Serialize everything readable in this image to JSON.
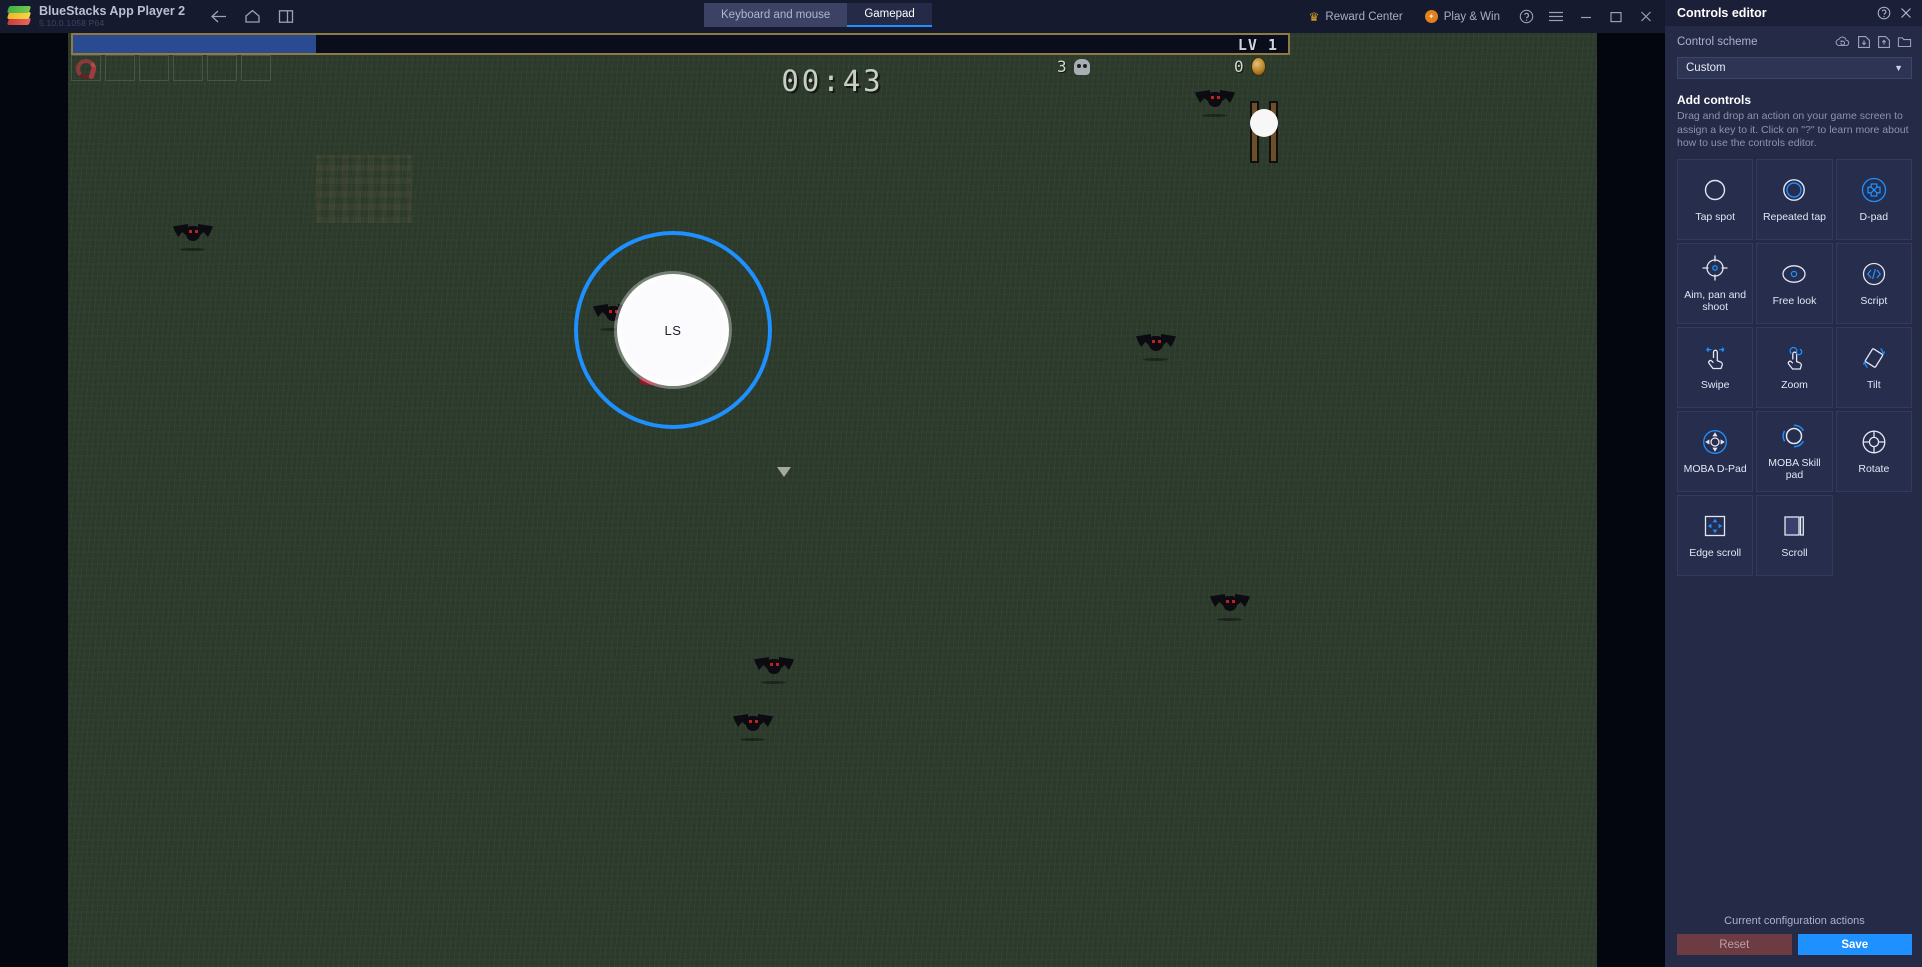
{
  "titlebar": {
    "app_title": "BlueStacks App Player 2",
    "version": "5.10.0.1058  P64",
    "logo_icon": "bluestacks-logo",
    "nav": [
      {
        "icon": "back-arrow-icon",
        "name": "back-button"
      },
      {
        "icon": "home-icon",
        "name": "home-button"
      },
      {
        "icon": "multi-instance-icon",
        "name": "multi-instance-button"
      }
    ],
    "tabs": [
      {
        "label": "Keyboard and mouse",
        "active": false
      },
      {
        "label": "Gamepad",
        "active": true
      }
    ],
    "reward_center": "Reward Center",
    "reward_icon": "crown-icon",
    "play_and_win": "Play & Win",
    "play_icon": "badge-icon",
    "help_icon": "help-circle-icon",
    "menu_icon": "hamburger-menu-icon",
    "minimize_icon": "minimize-icon",
    "maximize_icon": "maximize-icon",
    "close_icon": "close-icon"
  },
  "game": {
    "level_text": "LV 1",
    "xp_percent": 20,
    "timer": "00:43",
    "kill_count": "3",
    "kill_icon": "skull-icon",
    "gold_count": "0",
    "gold_icon": "coin-icon",
    "joystick_label": "LS",
    "inventory_slots": 6,
    "accent_xp_fill": "#2a4a91",
    "accent_xp_border": "#8e7a43",
    "grass_color": "#2c3a2b",
    "joystick_ring_color": "#1e90ff"
  },
  "editor": {
    "title": "Controls editor",
    "help_icon": "help-circle-icon",
    "close_icon": "close-icon",
    "scheme_label": "Control scheme",
    "scheme_icons": [
      {
        "icon": "cloud-sync-icon",
        "name": "cloud-sync-button"
      },
      {
        "icon": "import-icon",
        "name": "import-scheme-button"
      },
      {
        "icon": "export-icon",
        "name": "export-scheme-button"
      },
      {
        "icon": "folder-icon",
        "name": "open-folder-button"
      }
    ],
    "scheme_value": "Custom",
    "scheme_caret": "chevron-down-icon",
    "add_title": "Add controls",
    "add_desc": "Drag and drop an action on your game screen to assign a key to it. Click on \"?\" to learn more about how to use the controls editor.",
    "controls": [
      {
        "label": "Tap spot",
        "icon": "tap-spot-icon"
      },
      {
        "label": "Repeated tap",
        "icon": "repeated-tap-icon"
      },
      {
        "label": "D-pad",
        "icon": "dpad-icon"
      },
      {
        "label": "Aim, pan and shoot",
        "icon": "aim-pan-shoot-icon"
      },
      {
        "label": "Free look",
        "icon": "free-look-icon"
      },
      {
        "label": "Script",
        "icon": "script-icon"
      },
      {
        "label": "Swipe",
        "icon": "swipe-icon"
      },
      {
        "label": "Zoom",
        "icon": "zoom-icon"
      },
      {
        "label": "Tilt",
        "icon": "tilt-icon"
      },
      {
        "label": "MOBA D-Pad",
        "icon": "moba-dpad-icon"
      },
      {
        "label": "MOBA Skill pad",
        "icon": "moba-skill-pad-icon"
      },
      {
        "label": "Rotate",
        "icon": "rotate-icon"
      },
      {
        "label": "Edge scroll",
        "icon": "edge-scroll-icon"
      },
      {
        "label": "Scroll",
        "icon": "scroll-icon"
      }
    ],
    "footer_title": "Current configuration actions",
    "reset_label": "Reset",
    "save_label": "Save",
    "reset_color": "#6d3b42",
    "save_color": "#1e90ff"
  }
}
